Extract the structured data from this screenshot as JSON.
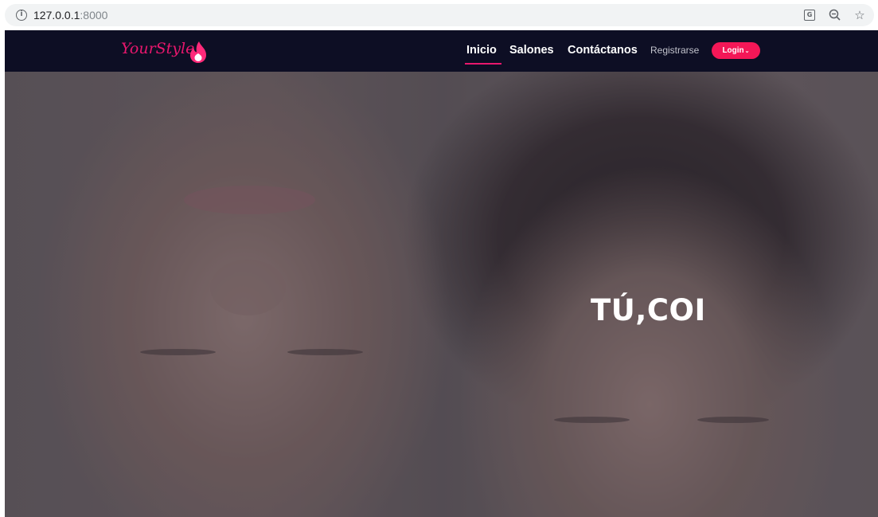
{
  "browser": {
    "url_host": "127.0.0.1",
    "url_port": ":8000",
    "icons": [
      "info-icon",
      "translate-icon",
      "zoom-icon",
      "star-icon"
    ]
  },
  "navbar": {
    "brand": "YourStyle",
    "links": [
      {
        "label": "Inicio",
        "active": true
      },
      {
        "label": "Salones"
      },
      {
        "label": "Contáctanos"
      }
    ],
    "register_label": "Registrarse",
    "login_label": "Login"
  },
  "hero": {
    "headline": "TÚ,COI"
  },
  "colors": {
    "navbar_bg": "#0d0e24",
    "accent": "#e8176d",
    "login_bg": "#f41757"
  }
}
